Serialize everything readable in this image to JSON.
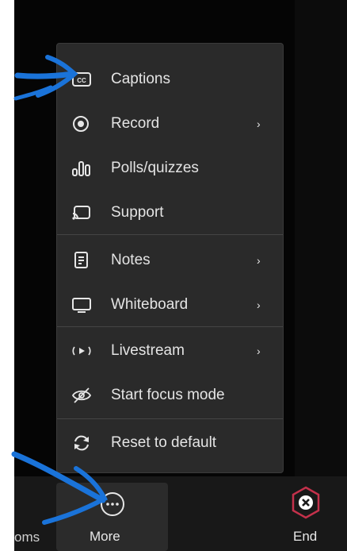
{
  "menu": {
    "items": [
      {
        "label": "Captions",
        "icon": "captions-icon",
        "submenu": false
      },
      {
        "label": "Record",
        "icon": "record-icon",
        "submenu": true
      },
      {
        "label": "Polls/quizzes",
        "icon": "polls-icon",
        "submenu": false
      },
      {
        "label": "Support",
        "icon": "support-icon",
        "submenu": false
      },
      {
        "label": "Notes",
        "icon": "notes-icon",
        "submenu": true
      },
      {
        "label": "Whiteboard",
        "icon": "whiteboard-icon",
        "submenu": true
      },
      {
        "label": "Livestream",
        "icon": "livestream-icon",
        "submenu": true
      },
      {
        "label": "Start focus mode",
        "icon": "focus-mode-icon",
        "submenu": false
      },
      {
        "label": "Reset to default",
        "icon": "reset-icon",
        "submenu": false
      }
    ],
    "chevron": "›"
  },
  "toolbar": {
    "rooms_label": "oms",
    "more_label": "More",
    "end_label": "End"
  },
  "colors": {
    "menu_bg": "#2a2a2a",
    "end_accent": "#c4314b",
    "annotation_blue": "#1a73d9"
  }
}
